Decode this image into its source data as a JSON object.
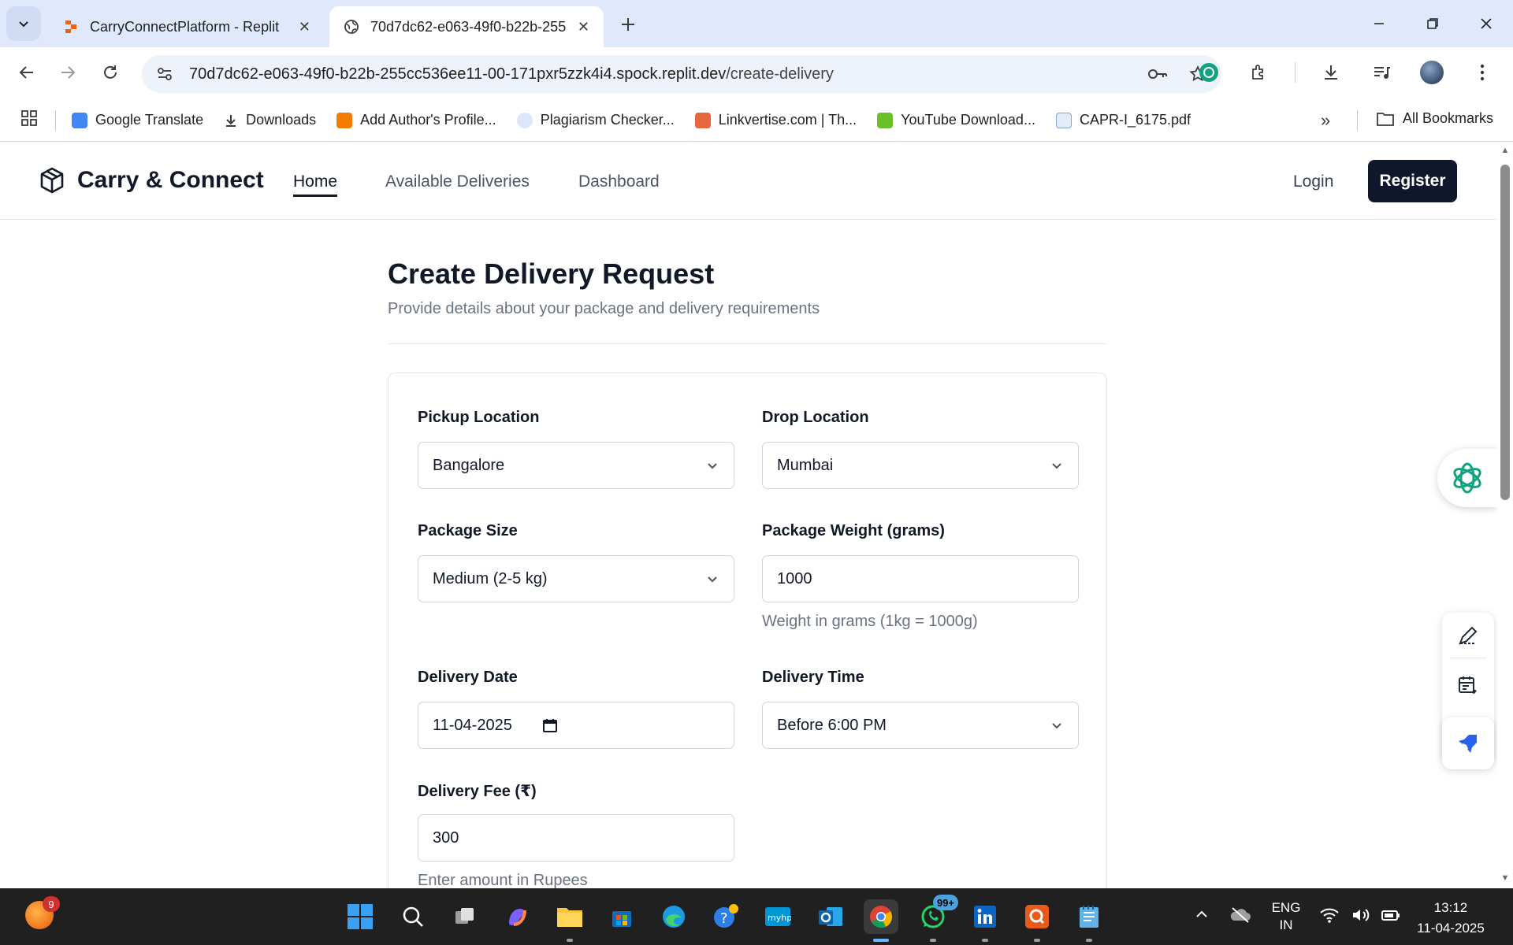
{
  "browser": {
    "tabs": [
      {
        "title": "CarryConnectPlatform - Replit",
        "icon": "replit-icon"
      },
      {
        "title": "70d7dc62-e063-49f0-b22b-255",
        "icon": "globe-icon",
        "active": true
      }
    ],
    "url_host": "70d7dc62-e063-49f0-b22b-255cc536ee11-00-171pxr5zzk4i4.spock.replit.dev",
    "url_path": "/create-delivery",
    "bookmarks": [
      {
        "label": "Google Translate",
        "icon": "google-translate-icon",
        "color": "#4285f4"
      },
      {
        "label": "Downloads",
        "icon": "download-icon",
        "color": "#3c3c3c"
      },
      {
        "label": "Add Author's Profile...",
        "icon": "blogger-icon",
        "color": "#f57c00"
      },
      {
        "label": "Plagiarism Checker...",
        "icon": "plagiarism-icon",
        "color": "#5b8def"
      },
      {
        "label": "Linkvertise.com | Th...",
        "icon": "linkvertise-icon",
        "color": "#e8663d"
      },
      {
        "label": "YouTube Download...",
        "icon": "youtube-download-icon",
        "color": "#6bbf2a"
      },
      {
        "label": "CAPR-I_6175.pdf",
        "icon": "pdf-file-icon",
        "color": "#7aa7d6"
      }
    ],
    "bookmarks_overflow": "»",
    "all_bookmarks": "All Bookmarks"
  },
  "site": {
    "brand": "Carry & Connect",
    "nav": [
      {
        "label": "Home",
        "active": true
      },
      {
        "label": "Available Deliveries",
        "active": false
      },
      {
        "label": "Dashboard",
        "active": false
      }
    ],
    "login": "Login",
    "register": "Register"
  },
  "form": {
    "title": "Create Delivery Request",
    "subtitle": "Provide details about your package and delivery requirements",
    "pickup": {
      "label": "Pickup Location",
      "value": "Bangalore"
    },
    "drop": {
      "label": "Drop Location",
      "value": "Mumbai"
    },
    "size": {
      "label": "Package Size",
      "value": "Medium (2-5 kg)"
    },
    "weight": {
      "label": "Package Weight (grams)",
      "value": "1000",
      "hint": "Weight in grams (1kg = 1000g)"
    },
    "date": {
      "label": "Delivery Date",
      "value": "11-04-2025"
    },
    "time": {
      "label": "Delivery Time",
      "value": "Before 6:00 PM"
    },
    "fee": {
      "label": "Delivery Fee (₹)",
      "value": "300",
      "hint": "Enter amount in Rupees"
    }
  },
  "taskbar": {
    "notification_count": "9",
    "whatsapp_badge": "99+",
    "language_top": "ENG",
    "language_bottom": "IN",
    "time": "13:12",
    "date": "11-04-2025"
  },
  "colors": {
    "accent_dark": "#0f172a",
    "chrome_bg": "#dfe9fb",
    "ai_green": "#10a37f"
  }
}
